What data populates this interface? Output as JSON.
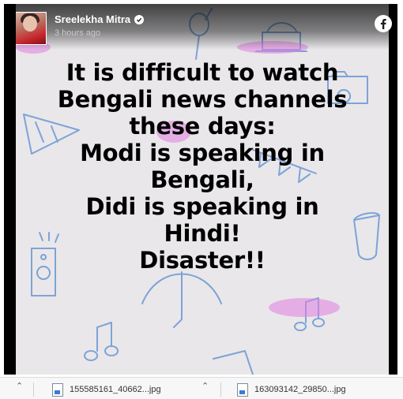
{
  "post": {
    "author": "Sreelekha Mitra",
    "timestamp": "3 hours ago",
    "verified_icon": "verified-check-icon",
    "platform_icon": "facebook-icon",
    "message_lines": [
      "It is difficult to watch",
      "Bengali news channels",
      "these days:",
      "Modi is speaking in",
      "Bengali,",
      "Didi is speaking in",
      "Hindi!",
      "Disaster!!"
    ]
  },
  "downloads": {
    "items": [
      {
        "name": "155585161_40662...jpg"
      },
      {
        "name": "163093142_29850...jpg"
      }
    ]
  },
  "colors": {
    "background": "#e9e7ea",
    "doodle_blue": "#7ea3d6",
    "doodle_pink": "#e07fe0",
    "text": "#000000",
    "facebook_blue": "#1877f2"
  }
}
